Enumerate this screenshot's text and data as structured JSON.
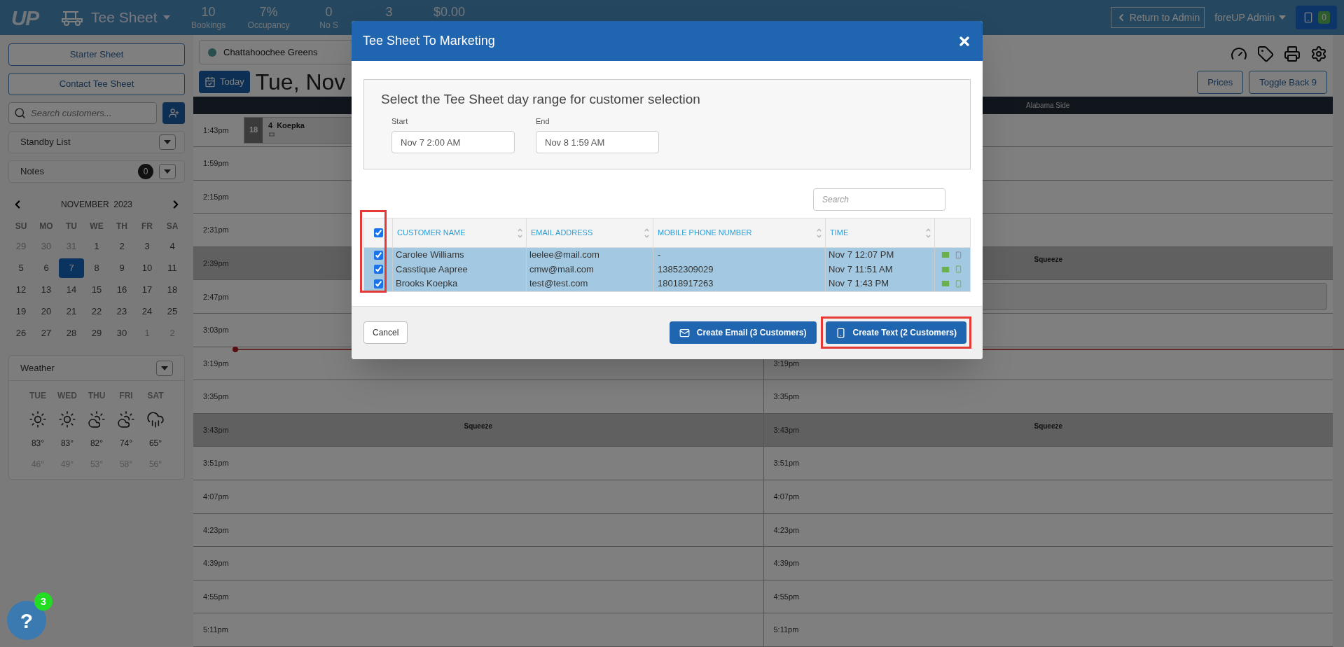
{
  "top_bar": {
    "logo": "UP",
    "app_title": "Tee Sheet",
    "stats": [
      {
        "value": "10",
        "label": "Bookings"
      },
      {
        "value": "7%",
        "label": "Occupancy"
      },
      {
        "value": "0",
        "label": "No S"
      },
      {
        "value": "3"
      },
      {
        "value": "$0.00"
      }
    ],
    "return_button": "Return to Admin",
    "user_menu": "foreUP Admin",
    "sms_count": "0"
  },
  "sidebar": {
    "buttons": [
      "Starter Sheet",
      "Contact Tee Sheet"
    ],
    "search": {
      "placeholder": "Search customers..."
    },
    "panels": [
      {
        "title": "Standby List"
      },
      {
        "title": "Notes",
        "count": "0"
      }
    ],
    "calendar": {
      "month": "NOVEMBER  2023",
      "weekdays": [
        "SU",
        "MO",
        "TU",
        "WE",
        "TH",
        "FR",
        "SA"
      ],
      "weeks": [
        [
          {
            "day": "29",
            "muted": true,
            "selected": false
          },
          {
            "day": "30",
            "muted": true,
            "selected": false
          },
          {
            "day": "31",
            "muted": true,
            "selected": false
          },
          {
            "day": "1",
            "muted": false,
            "selected": false
          },
          {
            "day": "2",
            "muted": false,
            "selected": false
          },
          {
            "day": "3",
            "muted": false,
            "selected": false
          },
          {
            "day": "4",
            "muted": false,
            "selected": false
          }
        ],
        [
          {
            "day": "5",
            "muted": false,
            "selected": false
          },
          {
            "day": "6",
            "muted": false,
            "selected": false
          },
          {
            "day": "7",
            "muted": false,
            "selected": true
          },
          {
            "day": "8",
            "muted": false,
            "selected": false
          },
          {
            "day": "9",
            "muted": false,
            "selected": false
          },
          {
            "day": "10",
            "muted": false,
            "selected": false
          },
          {
            "day": "11",
            "muted": false,
            "selected": false
          }
        ],
        [
          {
            "day": "12",
            "muted": false,
            "selected": false
          },
          {
            "day": "13",
            "muted": false,
            "selected": false
          },
          {
            "day": "14",
            "muted": false,
            "selected": false
          },
          {
            "day": "15",
            "muted": false,
            "selected": false
          },
          {
            "day": "16",
            "muted": false,
            "selected": false
          },
          {
            "day": "17",
            "muted": false,
            "selected": false
          },
          {
            "day": "18",
            "muted": false,
            "selected": false
          }
        ],
        [
          {
            "day": "19",
            "muted": false,
            "selected": false
          },
          {
            "day": "20",
            "muted": false,
            "selected": false
          },
          {
            "day": "21",
            "muted": false,
            "selected": false
          },
          {
            "day": "22",
            "muted": false,
            "selected": false
          },
          {
            "day": "23",
            "muted": false,
            "selected": false
          },
          {
            "day": "24",
            "muted": false,
            "selected": false
          },
          {
            "day": "25",
            "muted": false,
            "selected": false
          }
        ],
        [
          {
            "day": "26",
            "muted": false,
            "selected": false
          },
          {
            "day": "27",
            "muted": false,
            "selected": false
          },
          {
            "day": "28",
            "muted": false,
            "selected": false
          },
          {
            "day": "29",
            "muted": false,
            "selected": false
          },
          {
            "day": "30",
            "muted": false,
            "selected": false
          },
          {
            "day": "1",
            "muted": true,
            "selected": false
          },
          {
            "day": "2",
            "muted": true,
            "selected": false
          }
        ]
      ]
    },
    "weather": {
      "title": "Weather",
      "days": [
        {
          "day": "TUE",
          "kind": "sunny",
          "high": "83°",
          "low": "46°"
        },
        {
          "day": "WED",
          "kind": "sunny",
          "high": "83°",
          "low": "49°"
        },
        {
          "day": "THU",
          "kind": "partly-cloudy",
          "high": "82°",
          "low": "53°"
        },
        {
          "day": "FRI",
          "kind": "partly-cloudy",
          "high": "74°",
          "low": "58°"
        },
        {
          "day": "SAT",
          "kind": "rain",
          "high": "65°",
          "low": "56°"
        }
      ]
    }
  },
  "tee_sheet": {
    "course": {
      "name": "Chattahoochee Greens"
    },
    "today_button": "Today",
    "date": "Tue, Nov",
    "toolbar_buttons": [
      "Prices",
      "Toggle Back 9"
    ],
    "side_header": "Alabama Side",
    "rows": [
      {
        "kind": "open",
        "cells": [
          {
            "time": "1:43pm",
            "booking": {
              "holes": "18",
              "players": "4",
              "name": "Koepka"
            }
          },
          {}
        ]
      },
      {
        "kind": "open",
        "cells": [
          {
            "time": "1:59pm"
          },
          {}
        ]
      },
      {
        "kind": "open",
        "cells": [
          {
            "time": "2:15pm"
          },
          {}
        ]
      },
      {
        "kind": "open",
        "cells": [
          {
            "time": "2:31pm"
          },
          {}
        ]
      },
      {
        "kind": "squeeze",
        "cells": [
          {
            "time": "2:39pm"
          },
          {
            "label": "Squeeze"
          }
        ]
      },
      {
        "kind": "open",
        "cells": [
          {
            "time": "2:47pm"
          },
          {
            "reserved": true
          }
        ]
      },
      {
        "kind": "open",
        "cells": [
          {
            "time": "3:03pm"
          },
          {}
        ]
      },
      {
        "kind": "open",
        "cells": [
          {
            "time": "3:19pm"
          },
          {
            "time": "3:19pm"
          }
        ]
      },
      {
        "kind": "open",
        "cells": [
          {
            "time": "3:35pm"
          },
          {
            "time": "3:35pm"
          }
        ]
      },
      {
        "kind": "squeeze",
        "cells": [
          {
            "time": "3:43pm",
            "label": "Squeeze"
          },
          {
            "time": "3:43pm",
            "label": "Squeeze"
          }
        ]
      },
      {
        "kind": "open",
        "cells": [
          {
            "time": "3:51pm"
          },
          {
            "time": "3:51pm"
          }
        ]
      },
      {
        "kind": "open",
        "cells": [
          {
            "time": "4:07pm"
          },
          {
            "time": "4:07pm"
          }
        ]
      },
      {
        "kind": "open",
        "cells": [
          {
            "time": "4:23pm"
          },
          {
            "time": "4:23pm"
          }
        ]
      },
      {
        "kind": "open",
        "cells": [
          {
            "time": "4:39pm"
          },
          {
            "time": "4:39pm"
          }
        ]
      },
      {
        "kind": "open",
        "cells": [
          {
            "time": "4:55pm"
          },
          {
            "time": "4:55pm"
          }
        ]
      },
      {
        "kind": "open",
        "cells": [
          {
            "time": "5:11pm"
          },
          {
            "time": "5:11pm"
          }
        ]
      }
    ]
  },
  "modal": {
    "title": "Tee Sheet To Marketing",
    "range_panel": {
      "heading": "Select the Tee Sheet day range for customer selection",
      "start": {
        "label": "Start",
        "value": "Nov 7 2:00 AM"
      },
      "end": {
        "label": "End",
        "value": "Nov 8 1:59 AM"
      }
    },
    "search": {
      "placeholder": "Search"
    },
    "table": {
      "select_all_checked": true,
      "checkbox_column_highlighted": true,
      "columns": [
        "CUSTOMER NAME",
        "EMAIL ADDRESS",
        "MOBILE PHONE NUMBER",
        "TIME"
      ],
      "rows": [
        {
          "checked": true,
          "selected": true,
          "name": "Carolee Williams",
          "email": "leelee@mail.com",
          "phone": "-",
          "time": "Nov 7 12:07 PM",
          "email_available": true,
          "phone_available": false
        },
        {
          "checked": true,
          "selected": true,
          "name": "Casstique Aapree",
          "email": "cmw@mail.com",
          "phone": "13852309029",
          "time": "Nov 7 11:51 AM",
          "email_available": true,
          "phone_available": true
        },
        {
          "checked": true,
          "selected": true,
          "name": "Brooks Koepka",
          "email": "test@test.com",
          "phone": "18018917263",
          "time": "Nov 7 1:43 PM",
          "email_available": true,
          "phone_available": true
        }
      ]
    },
    "buttons": [
      {
        "kind": "cancel",
        "label": "Cancel"
      },
      {
        "kind": "email",
        "label": "Create Email (3 Customers)"
      },
      {
        "kind": "text",
        "label": "Create Text (2 Customers)"
      }
    ],
    "text_button_highlighted": true
  },
  "help": {
    "label": "?",
    "badge": "3"
  }
}
